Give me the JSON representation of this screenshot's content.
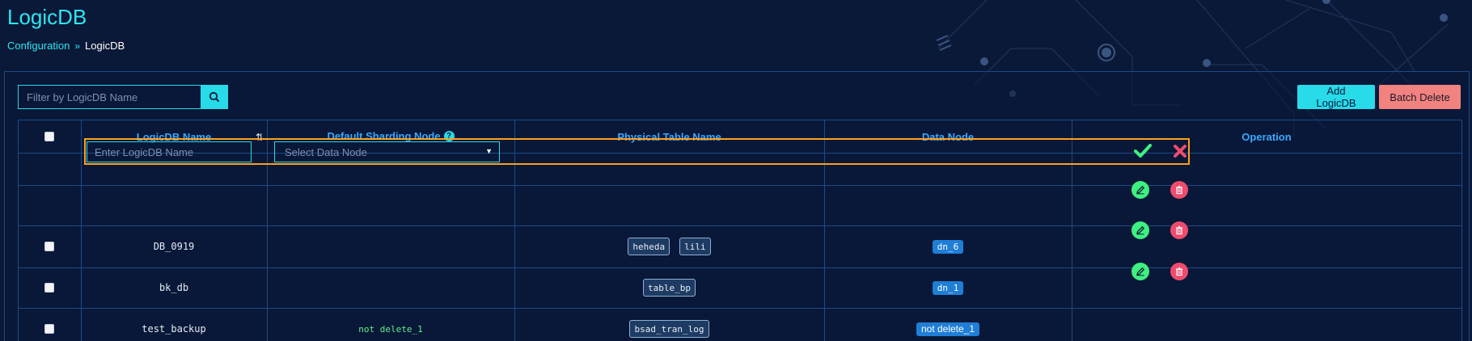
{
  "page": {
    "title": "LogicDB",
    "breadcrumb": {
      "parent": "Configuration",
      "separator": "»",
      "current": "LogicDB"
    }
  },
  "toolbar": {
    "filter_placeholder": "Filter by LogicDB Name",
    "add_label": "Add LogicDB",
    "batch_delete_label": "Batch Delete"
  },
  "table": {
    "columns": {
      "name": "LogicDB Name",
      "sharding": "Default Sharding Node",
      "physical": "Physical Table Name",
      "datanode": "Data Node",
      "operation": "Operation"
    },
    "new_row": {
      "name_placeholder": "Enter LogicDB Name",
      "node_placeholder": "Select Data Node"
    },
    "rows": [
      {
        "name": "DB_0919",
        "sharding": "",
        "tables": [
          "heheda",
          "lili"
        ],
        "node": "dn_6"
      },
      {
        "name": "bk_db",
        "sharding": "",
        "tables": [
          "table_bp"
        ],
        "node": "dn_1"
      },
      {
        "name": "test_backup",
        "sharding": "not delete_1",
        "tables": [
          "bsad_tran_log"
        ],
        "node": "not delete_1"
      }
    ]
  },
  "colors": {
    "accent": "#27dbe9",
    "danger": "#f2827f",
    "header_text": "#3aa9ff",
    "edit_border": "#ff9f1a"
  }
}
